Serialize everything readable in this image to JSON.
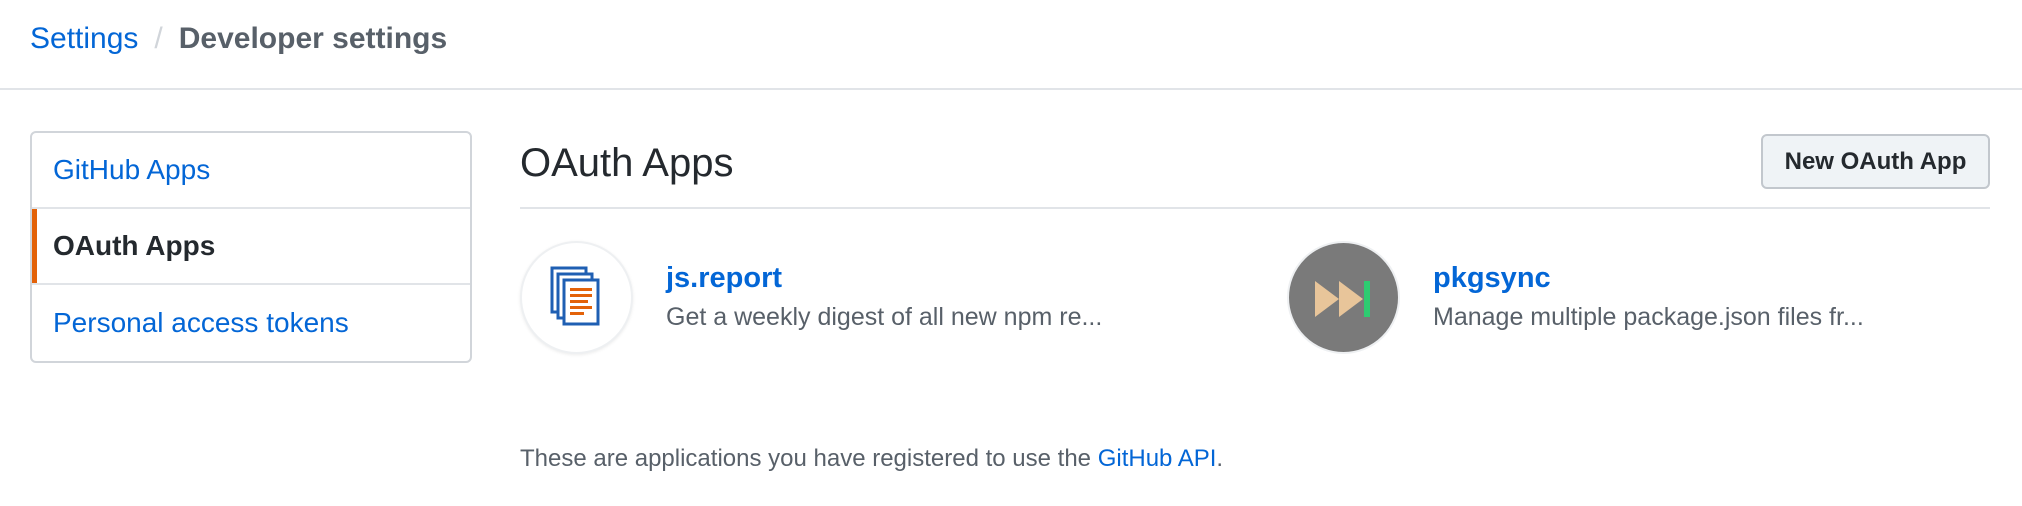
{
  "breadcrumb": {
    "root": "Settings",
    "separator": "/",
    "current": "Developer settings"
  },
  "sidebar": {
    "items": [
      {
        "label": "GitHub Apps",
        "selected": false
      },
      {
        "label": "OAuth Apps",
        "selected": true
      },
      {
        "label": "Personal access tokens",
        "selected": false
      }
    ]
  },
  "main": {
    "title": "OAuth Apps",
    "new_button_label": "New OAuth App"
  },
  "apps": [
    {
      "name": "js.report",
      "description": "Get a weekly digest of all new npm re...",
      "icon": "document-stack-icon"
    },
    {
      "name": "pkgsync",
      "description": "Manage multiple package.json files fr...",
      "icon": "fast-forward-icon"
    }
  ],
  "footer": {
    "text_before": "These are applications you have registered to use the ",
    "link_text": "GitHub API",
    "text_after": "."
  },
  "colors": {
    "link": "#0366d6",
    "selected_accent": "#e36209",
    "pkgsync_avatar_bg": "#7a7a7a"
  }
}
